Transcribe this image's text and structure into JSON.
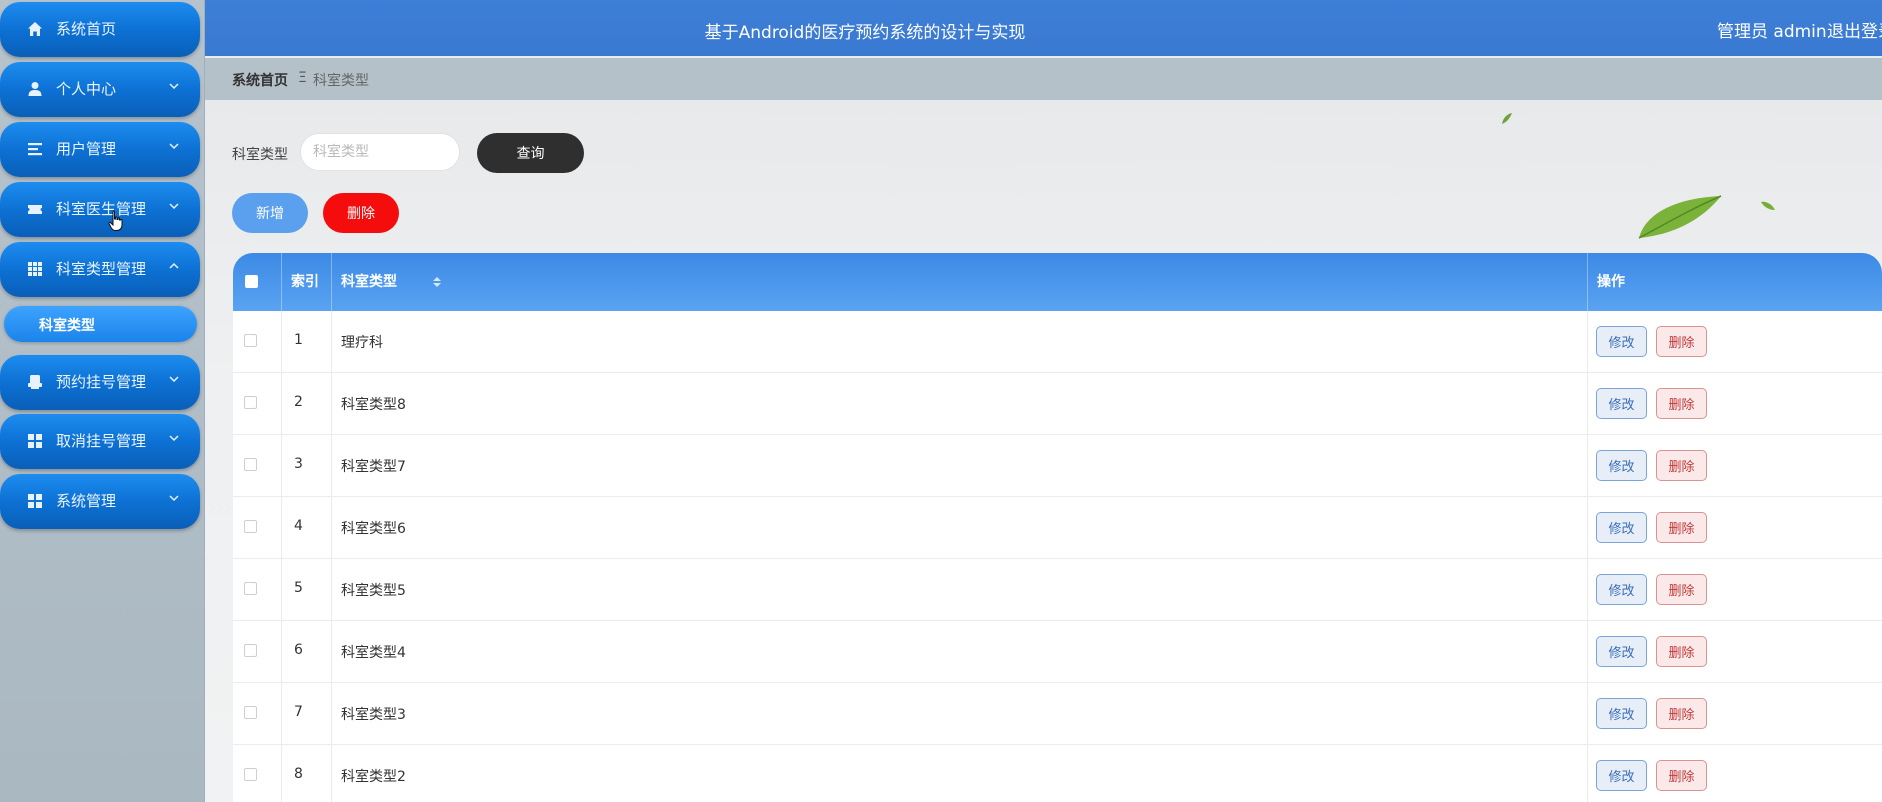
{
  "header": {
    "title": "基于Android的医疗预约系统的设计与实现",
    "user": "管理员 admin",
    "logout": "退出登录"
  },
  "sidebar": {
    "items": [
      {
        "label": "系统首页",
        "icon": "home-icon"
      },
      {
        "label": "个人中心",
        "icon": "user-icon",
        "expanded": false
      },
      {
        "label": "用户管理",
        "icon": "list-icon",
        "expanded": false
      },
      {
        "label": "科室医生管理",
        "icon": "ticket-icon",
        "expanded": false
      },
      {
        "label": "科室类型管理",
        "icon": "grid-icon",
        "expanded": true
      },
      {
        "label": "预约挂号管理",
        "icon": "printer-icon",
        "expanded": false
      },
      {
        "label": "取消挂号管理",
        "icon": "apps-icon",
        "expanded": false
      },
      {
        "label": "系统管理",
        "icon": "apps-icon",
        "expanded": false
      }
    ],
    "active_sub": "科室类型"
  },
  "breadcrumb": {
    "home": "系统首页",
    "separator": "Ξ",
    "current": "科室类型"
  },
  "search": {
    "label": "科室类型",
    "placeholder": "科室类型",
    "value": "",
    "query_button": "查询"
  },
  "actions": {
    "add": "新增",
    "delete": "删除"
  },
  "table": {
    "columns": [
      "索引",
      "科室类型",
      "操作"
    ],
    "rows": [
      {
        "index": "1",
        "type": "理疗科"
      },
      {
        "index": "2",
        "type": "科室类型8"
      },
      {
        "index": "3",
        "type": "科室类型7"
      },
      {
        "index": "4",
        "type": "科室类型6"
      },
      {
        "index": "5",
        "type": "科室类型5"
      },
      {
        "index": "6",
        "type": "科室类型4"
      },
      {
        "index": "7",
        "type": "科室类型3"
      },
      {
        "index": "8",
        "type": "科室类型2"
      }
    ],
    "row_edit": "修改",
    "row_delete": "删除"
  },
  "colors": {
    "header_bg": "#3a79d1",
    "sidebar_item": "#0c6fd1",
    "query_button": "#2f2f2f",
    "add_button": "#5aa0ee",
    "delete_button": "#f50d0d",
    "table_header": "#4a96ec"
  }
}
